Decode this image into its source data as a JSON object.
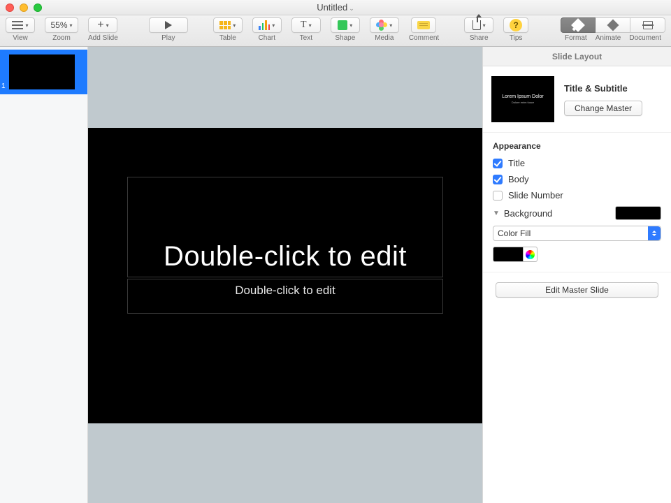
{
  "window": {
    "title": "Untitled"
  },
  "toolbar": {
    "view": "View",
    "zoom_label": "Zoom",
    "zoom_value": "55%",
    "add_slide": "Add Slide",
    "play": "Play",
    "table": "Table",
    "chart": "Chart",
    "text": "Text",
    "shape": "Shape",
    "media": "Media",
    "comment": "Comment",
    "share": "Share",
    "tips": "Tips",
    "format": "Format",
    "animate": "Animate",
    "document": "Document"
  },
  "thumbnails": {
    "items": [
      {
        "num": "1"
      }
    ]
  },
  "slide": {
    "title_placeholder": "Double-click to edit",
    "subtitle_placeholder": "Double-click to edit"
  },
  "inspector": {
    "header": "Slide Layout",
    "master_thumb_title": "Lorem Ipsum Dolor",
    "master_thumb_sub": "Dolore enim fusce",
    "master_name": "Title & Subtitle",
    "change_master": "Change Master",
    "appearance": {
      "label": "Appearance",
      "title": {
        "label": "Title",
        "checked": true
      },
      "body": {
        "label": "Body",
        "checked": true
      },
      "slide_number": {
        "label": "Slide Number",
        "checked": false
      }
    },
    "background": {
      "label": "Background",
      "fill_mode": "Color Fill",
      "color": "#000000"
    },
    "edit_master": "Edit Master Slide"
  }
}
